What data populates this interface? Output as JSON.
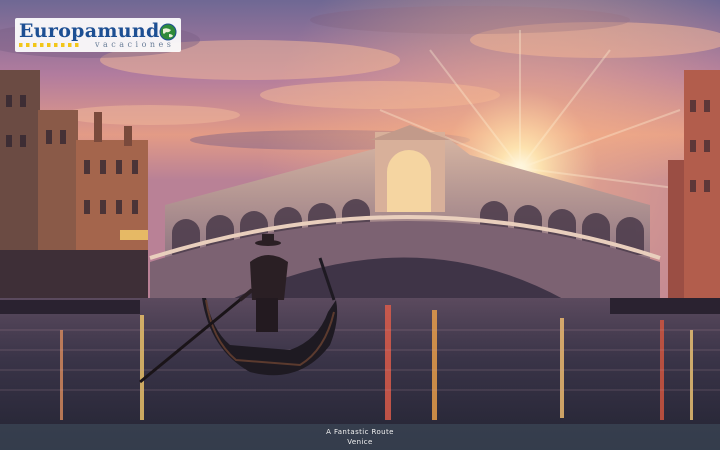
{
  "slide": {
    "photo_subject": "Rialto Bridge with gondolier at sunset, Venice",
    "logo": {
      "name": "Europamund",
      "tagline": "vacaciones",
      "icon": "globe-icon",
      "colors": {
        "wordmark": "#1d4f93",
        "stars": "#f2c619",
        "globe": "#2e8a3a"
      }
    },
    "caption": {
      "line1": "A Fantastic Route",
      "line2": "Venice"
    }
  }
}
